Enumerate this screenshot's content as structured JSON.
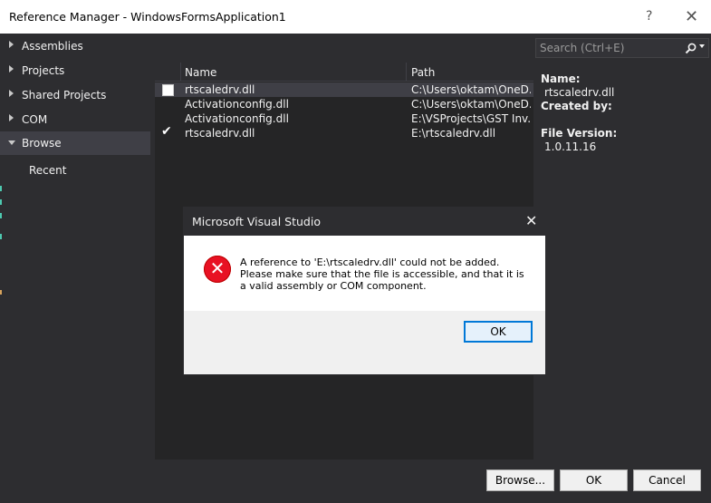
{
  "window": {
    "title": "Reference Manager - WindowsFormsApplication1",
    "help_glyph": "?",
    "close_glyph": "✕"
  },
  "sidebar": {
    "items": [
      {
        "label": "Assemblies"
      },
      {
        "label": "Projects"
      },
      {
        "label": "Shared Projects"
      },
      {
        "label": "COM"
      },
      {
        "label": "Browse"
      },
      {
        "label": "Recent"
      }
    ]
  },
  "search": {
    "placeholder": "Search (Ctrl+E)",
    "icon": "search-icon"
  },
  "list": {
    "columns": {
      "name": "Name",
      "path": "Path"
    },
    "rows": [
      {
        "name": "rtscaledrv.dll",
        "path": "C:\\Users\\oktam\\OneD...",
        "checked": false
      },
      {
        "name": "Activationconfig.dll",
        "path": "C:\\Users\\oktam\\OneD...",
        "checked": null
      },
      {
        "name": "Activationconfig.dll",
        "path": "E:\\VSProjects\\GST Inv...",
        "checked": null
      },
      {
        "name": "rtscaledrv.dll",
        "path": "E:\\rtscaledrv.dll",
        "checked": true
      }
    ]
  },
  "details": {
    "name_label": "Name:",
    "name_value": "rtscaledrv.dll",
    "created_label": "Created by:",
    "version_label": "File Version:",
    "version_value": "1.0.11.16"
  },
  "footer": {
    "browse": "Browse...",
    "ok": "OK",
    "cancel": "Cancel"
  },
  "dialog": {
    "title": "Microsoft Visual Studio",
    "close_glyph": "✕",
    "message": "A reference to 'E:\\rtscaledrv.dll' could not be added. Please make sure that the file is accessible, and that it is a valid assembly or COM component.",
    "ok": "OK",
    "icon": "error-icon"
  },
  "colors": {
    "background": "#2d2d30",
    "list_bg": "#252526",
    "selected": "#3f3f46",
    "error_red": "#e81123",
    "accent_blue": "#0078d7"
  }
}
